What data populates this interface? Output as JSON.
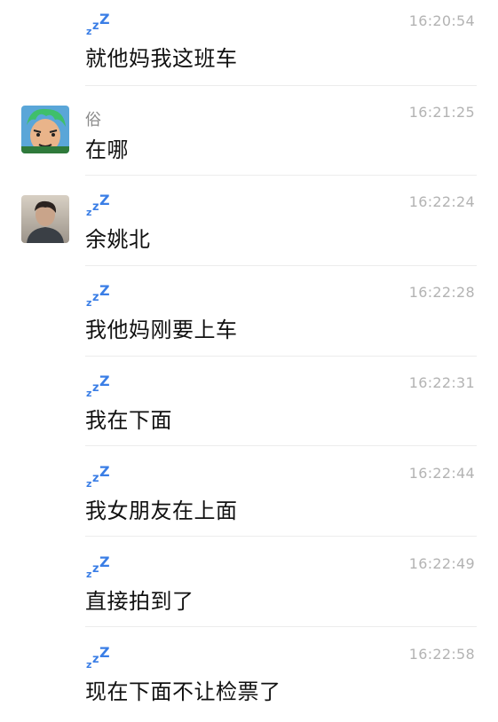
{
  "colors": {
    "background": "#ffffff",
    "message_text": "#111111",
    "timestamp": "#b3b3b3",
    "sender_name": "#8a8a8a",
    "zzz_icon": "#3a7ee6",
    "divider": "#ececec"
  },
  "messages": [
    {
      "sender_icon": "zzz-icon",
      "sender_name": "",
      "time": "16:20:54",
      "text": "就他妈我这班车",
      "avatar": "none"
    },
    {
      "sender_icon": "",
      "sender_name": "俗",
      "time": "16:21:25",
      "text": "在哪",
      "avatar": "cartoon-green-hair-avatar"
    },
    {
      "sender_icon": "zzz-icon",
      "sender_name": "",
      "time": "16:22:24",
      "text": "余姚北",
      "avatar": "photo-avatar"
    },
    {
      "sender_icon": "zzz-icon",
      "sender_name": "",
      "time": "16:22:28",
      "text": "我他妈刚要上车",
      "avatar": "none"
    },
    {
      "sender_icon": "zzz-icon",
      "sender_name": "",
      "time": "16:22:31",
      "text": "我在下面",
      "avatar": "none"
    },
    {
      "sender_icon": "zzz-icon",
      "sender_name": "",
      "time": "16:22:44",
      "text": "我女朋友在上面",
      "avatar": "none"
    },
    {
      "sender_icon": "zzz-icon",
      "sender_name": "",
      "time": "16:22:49",
      "text": "直接拍到了",
      "avatar": "none"
    },
    {
      "sender_icon": "zzz-icon",
      "sender_name": "",
      "time": "16:22:58",
      "text": "现在下面不让检票了",
      "avatar": "none"
    }
  ]
}
